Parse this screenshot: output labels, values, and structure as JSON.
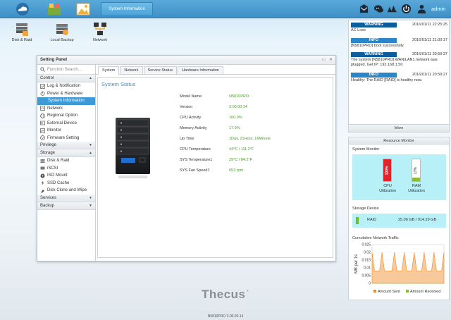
{
  "topbar": {
    "icons": [
      "cloud-icon",
      "apps-icon",
      "photo-icon"
    ],
    "active_tab": "System Information",
    "right_icons": [
      "mail-icon",
      "chat-icon",
      "monitor-icon",
      "power-icon",
      "user-icon"
    ],
    "user": "admin"
  },
  "desktop": {
    "icons": [
      {
        "label": "Disk & Raid",
        "icon": "disk-raid-icon"
      },
      {
        "label": "Local Backup",
        "icon": "local-backup-icon"
      },
      {
        "label": "Network",
        "icon": "network-icon"
      }
    ]
  },
  "panel": {
    "title": "Setting Panel",
    "controls": [
      "▭",
      "✕"
    ],
    "search_placeholder": "Function Search...",
    "sections": {
      "control": "Control",
      "privilege": "Privilege",
      "storage": "Storage",
      "services": "Services",
      "backup": "Backup"
    },
    "control_items": [
      "Log & Notification",
      "Power & Hardware",
      "System Information",
      "Network",
      "Regional Option",
      "External Device",
      "Monitor",
      "Firmware Setting"
    ],
    "storage_items": [
      "Disk & Raid",
      "iSCSI",
      "ISO Mount",
      "SSD Cache",
      "Disk Clone and Wipe"
    ],
    "tabs": [
      "System",
      "Network",
      "Service Status",
      "Hardware Information"
    ],
    "heading": "System Status",
    "status": [
      {
        "k": "Model Name",
        "v": "N5810PRO"
      },
      {
        "k": "Version",
        "v": "3.00.00.14"
      },
      {
        "k": "CPU Activity",
        "v": "100.0%"
      },
      {
        "k": "Memory Activity",
        "v": "17.9%"
      },
      {
        "k": "Up Time",
        "v": "1Day, 21Hour, 16Minute"
      },
      {
        "k": "CPU Temperature",
        "v": "44°C / 111.2°F"
      },
      {
        "k": "SYS Temperature1",
        "v": "29°C / 84.2°F"
      },
      {
        "k": "SYS Fan Speed1",
        "v": "653 rpm"
      }
    ]
  },
  "notifications": {
    "items": [
      {
        "level": "WARNING",
        "time": "2016/01/11 22:25:25",
        "msg": "AC Lose"
      },
      {
        "level": "INFO",
        "time": "2016/01/11 21:00:17",
        "msg": "[N5810PRO] boot successfully."
      },
      {
        "level": "WARNING",
        "time": "2016/01/11 20:59:37",
        "msg": "The system [N5810PRO] WAN/LAN1 network was plugged. Get IP: 192.168.1.50"
      },
      {
        "level": "INFO",
        "time": "2016/01/11 20:59:27",
        "msg": "Healthy: The RAID [RAID] is healthy now."
      }
    ],
    "more": "More"
  },
  "resource_monitor": {
    "title": "Resource Monitor",
    "system_monitor": "System Monitor",
    "cpu": {
      "label": "CPU Utilization",
      "label1": "CPU",
      "label2": "Utilization",
      "pct": "100%",
      "level": 1.0,
      "color": "#e0242b"
    },
    "ram": {
      "label": "RAM Utilization",
      "label1": "RAM",
      "label2": "Utilization",
      "pct": "17%",
      "level": 0.17,
      "color": "#8bbf2a"
    },
    "storage_device": "Storage Device",
    "raid": {
      "name": "RAID",
      "usage": "25.06 GB / 914.29 GB"
    },
    "traffic_title": "Cumulative Network Traffic",
    "ylabel": "MB per 1s",
    "legend": [
      "Amount Sent",
      "Amount Received"
    ],
    "legend_colors": [
      "#f08a24",
      "#8bbf2a"
    ]
  },
  "chart_data": {
    "type": "area",
    "title": "Cumulative Network Traffic",
    "ylabel": "MB per 1s",
    "ylim": [
      0,
      0.025
    ],
    "yticks": [
      "0.025",
      "0.02",
      "0.015",
      "0.01",
      "0.005",
      "0"
    ],
    "series": [
      {
        "name": "Amount Sent",
        "values": [
          0.02,
          0.008,
          0.008,
          0.008,
          0.02,
          0.008,
          0.008,
          0.008,
          0.008,
          0.02,
          0.008,
          0.008,
          0.008,
          0.02,
          0.008,
          0.008,
          0.008,
          0.02,
          0.008,
          0.008,
          0.008,
          0.02,
          0.008,
          0.008,
          0.008,
          0.02,
          0.008,
          0.008,
          0.008,
          0.02
        ]
      },
      {
        "name": "Amount Received",
        "values": [
          0,
          0,
          0,
          0,
          0,
          0,
          0,
          0,
          0,
          0,
          0,
          0,
          0,
          0,
          0,
          0,
          0,
          0,
          0,
          0,
          0,
          0,
          0,
          0,
          0,
          0,
          0,
          0,
          0,
          0
        ]
      }
    ],
    "legend": "bottom"
  },
  "footer": {
    "brand": "Thecus",
    "version": "N5810PRO   3.00.00.14"
  }
}
